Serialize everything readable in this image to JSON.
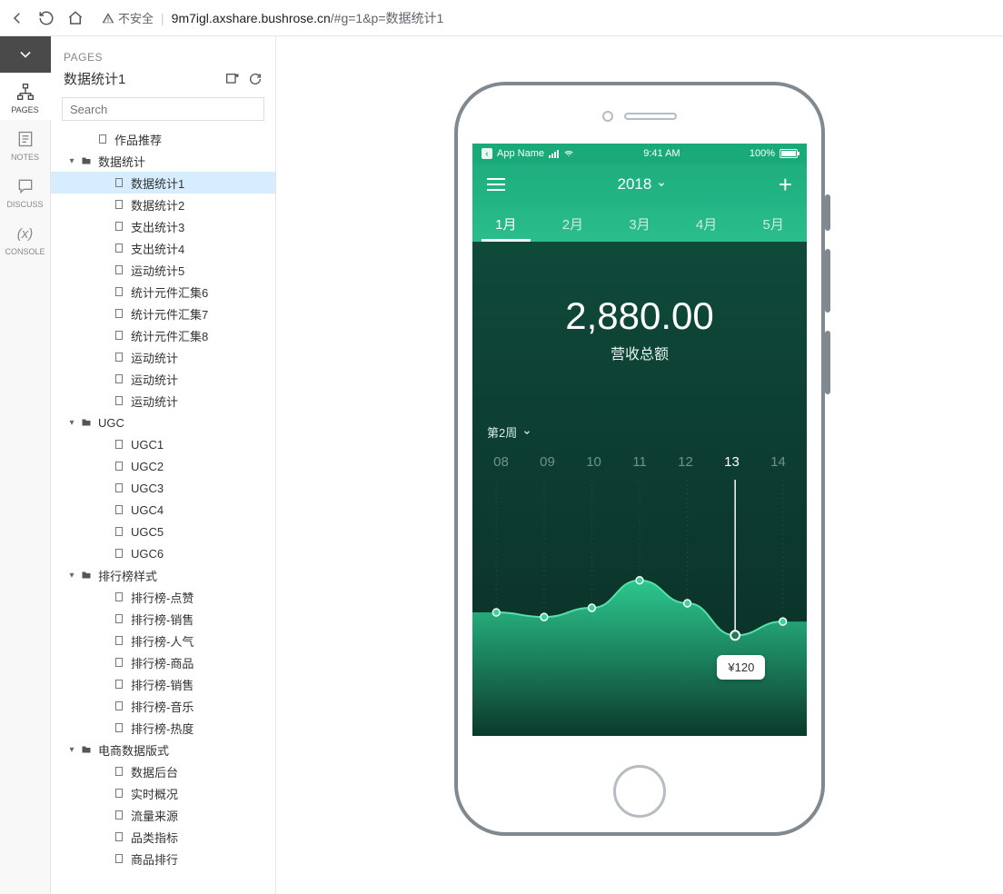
{
  "browser": {
    "insecure_label": "不安全",
    "url_host": "9m7igl.axshare.bushrose.cn",
    "url_path": "/#g=1&p=数据统计1"
  },
  "rail": {
    "pages": "PAGES",
    "notes": "NOTES",
    "discuss": "DISCUSS",
    "console": "CONSOLE",
    "console_sym": "(x)"
  },
  "panel": {
    "section": "PAGES",
    "title": "数据统计1",
    "search_placeholder": "Search"
  },
  "tree": [
    {
      "lvl": 1,
      "type": "page",
      "label": "作品推荐"
    },
    {
      "lvl": 0,
      "type": "folder",
      "label": "数据统计",
      "open": true
    },
    {
      "lvl": 2,
      "type": "page",
      "label": "数据统计1",
      "selected": true
    },
    {
      "lvl": 2,
      "type": "page",
      "label": "数据统计2"
    },
    {
      "lvl": 2,
      "type": "page",
      "label": "支出统计3"
    },
    {
      "lvl": 2,
      "type": "page",
      "label": "支出统计4"
    },
    {
      "lvl": 2,
      "type": "page",
      "label": "运动统计5"
    },
    {
      "lvl": 2,
      "type": "page",
      "label": "统计元件汇集6"
    },
    {
      "lvl": 2,
      "type": "page",
      "label": "统计元件汇集7"
    },
    {
      "lvl": 2,
      "type": "page",
      "label": "统计元件汇集8"
    },
    {
      "lvl": 2,
      "type": "page",
      "label": "运动统计"
    },
    {
      "lvl": 2,
      "type": "page",
      "label": "运动统计"
    },
    {
      "lvl": 2,
      "type": "page",
      "label": "运动统计"
    },
    {
      "lvl": 0,
      "type": "folder",
      "label": "UGC",
      "open": true
    },
    {
      "lvl": 2,
      "type": "page",
      "label": "UGC1"
    },
    {
      "lvl": 2,
      "type": "page",
      "label": "UGC2"
    },
    {
      "lvl": 2,
      "type": "page",
      "label": "UGC3"
    },
    {
      "lvl": 2,
      "type": "page",
      "label": "UGC4"
    },
    {
      "lvl": 2,
      "type": "page",
      "label": "UGC5"
    },
    {
      "lvl": 2,
      "type": "page",
      "label": "UGC6"
    },
    {
      "lvl": 0,
      "type": "folder",
      "label": "排行榜样式",
      "open": true
    },
    {
      "lvl": 2,
      "type": "page",
      "label": "排行榜-点赞"
    },
    {
      "lvl": 2,
      "type": "page",
      "label": "排行榜-销售"
    },
    {
      "lvl": 2,
      "type": "page",
      "label": "排行榜-人气"
    },
    {
      "lvl": 2,
      "type": "page",
      "label": "排行榜-商品"
    },
    {
      "lvl": 2,
      "type": "page",
      "label": "排行榜-销售"
    },
    {
      "lvl": 2,
      "type": "page",
      "label": "排行榜-音乐"
    },
    {
      "lvl": 2,
      "type": "page",
      "label": "排行榜-热度"
    },
    {
      "lvl": 0,
      "type": "folder",
      "label": "电商数据版式",
      "open": true
    },
    {
      "lvl": 2,
      "type": "page",
      "label": "数据后台"
    },
    {
      "lvl": 2,
      "type": "page",
      "label": "实时概况"
    },
    {
      "lvl": 2,
      "type": "page",
      "label": "流量来源"
    },
    {
      "lvl": 2,
      "type": "page",
      "label": "品类指标"
    },
    {
      "lvl": 2,
      "type": "page",
      "label": "商品排行"
    }
  ],
  "status": {
    "app_name": "App Name",
    "time": "9:41 AM",
    "battery": "100%"
  },
  "app": {
    "year": "2018",
    "months": [
      "1月",
      "2月",
      "3月",
      "4月",
      "5月"
    ],
    "active_month": 0,
    "total": "2,880.00",
    "total_label": "营收总额",
    "week_label": "第2周",
    "tooltip": "¥120"
  },
  "chart_data": {
    "type": "area",
    "categories": [
      "08",
      "09",
      "10",
      "11",
      "12",
      "13",
      "14"
    ],
    "values": [
      95,
      90,
      100,
      130,
      105,
      70,
      85
    ],
    "selected_index": 5,
    "selected_label": "¥120",
    "ylim": [
      0,
      200
    ],
    "title": "",
    "xlabel": "",
    "ylabel": ""
  }
}
